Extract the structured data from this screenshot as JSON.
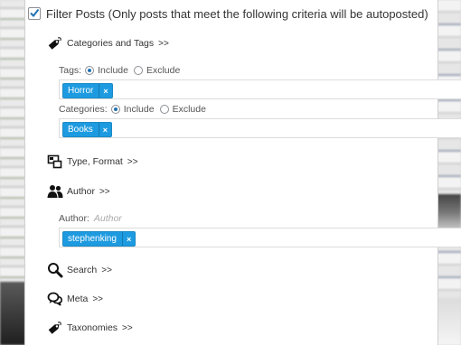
{
  "header": {
    "checked": true,
    "label": "Filter Posts (Only posts that meet the following criteria will be autoposted)"
  },
  "sections": {
    "categories_tags": {
      "label": "Categories and Tags",
      "chevron": ">>",
      "icon": "tag-icon"
    },
    "type_format": {
      "label": "Type, Format",
      "chevron": ">>",
      "icon": "type-format-icon"
    },
    "author": {
      "label": "Author",
      "chevron": ">>",
      "icon": "users-icon"
    },
    "search": {
      "label": "Search",
      "chevron": ">>",
      "icon": "search-icon"
    },
    "meta": {
      "label": "Meta",
      "chevron": ">>",
      "icon": "comments-icon"
    },
    "taxonomies": {
      "label": "Taxonomies",
      "chevron": ">>",
      "icon": "tag-icon"
    }
  },
  "tags_field": {
    "label": "Tags:",
    "include_label": "Include",
    "exclude_label": "Exclude",
    "selected": "Include",
    "tokens": [
      "Horror"
    ]
  },
  "categories_field": {
    "label": "Categories:",
    "include_label": "Include",
    "exclude_label": "Exclude",
    "selected": "Include",
    "tokens": [
      "Books"
    ]
  },
  "author_field": {
    "label": "Author:",
    "placeholder": "Author",
    "tokens": [
      "stephenking"
    ]
  },
  "token_remove_glyph": "×",
  "colors": {
    "token_bg": "#1e9be0",
    "radio_on": "#2271b1"
  }
}
